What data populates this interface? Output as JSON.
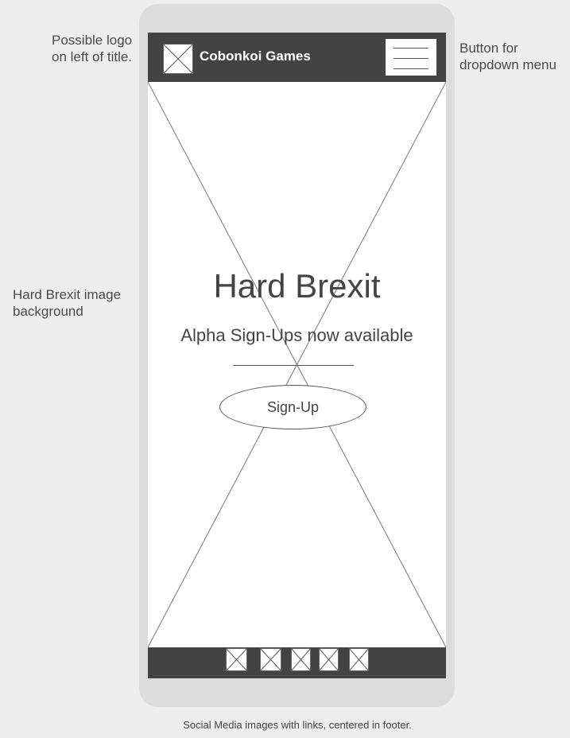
{
  "annotations": {
    "logo": "Possible logo on left of title.",
    "menu": "Button for dropdown menu",
    "image": "Hard Brexit image background",
    "footer": "Social Media images with links, centered in footer."
  },
  "header": {
    "title": "Cobonkoi Games",
    "logo_icon": "image-placeholder-icon",
    "menu_icon": "hamburger-menu-icon"
  },
  "hero": {
    "title": "Hard Brexit",
    "subtitle": "Alpha Sign-Ups now available",
    "button_label": "Sign-Up",
    "background_icon": "image-placeholder-icon"
  },
  "footer": {
    "social_links": [
      {
        "icon": "social-image-placeholder-icon"
      },
      {
        "icon": "social-image-placeholder-icon"
      },
      {
        "icon": "social-image-placeholder-icon"
      },
      {
        "icon": "social-image-placeholder-icon"
      },
      {
        "icon": "social-image-placeholder-icon"
      }
    ]
  },
  "colors": {
    "page_background": "#ededed",
    "phone_frame": "#dcdcdc",
    "header_footer": "#434343",
    "text": "#444444"
  }
}
